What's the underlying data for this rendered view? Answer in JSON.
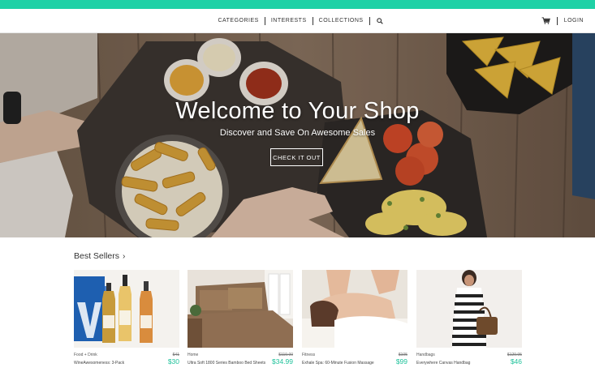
{
  "colors": {
    "accent": "#1fd1a6",
    "price": "#1fc29b"
  },
  "nav": {
    "links": [
      "CATEGORIES",
      "INTERESTS",
      "COLLECTIONS"
    ],
    "search_icon": "search-icon",
    "cart_icon": "cart-icon",
    "login": "LOGIN"
  },
  "hero": {
    "title": "Welcome to Your Shop",
    "subtitle": "Discover and Save On Awesome Sales",
    "button": "CHECK IT OUT"
  },
  "best_sellers": {
    "title": "Best Sellers",
    "chevron": "›",
    "items": [
      {
        "category": "Food + Drink",
        "name": "WineAwesomeness: 3-Pack",
        "old_price": "$41",
        "price": "$30"
      },
      {
        "category": "Home",
        "name": "Ultra Soft 1800 Series Bamboo Bed Sheets",
        "old_price": "$119.00",
        "price": "$34.99"
      },
      {
        "category": "Fitness",
        "name": "Exhale Spa: 60-Minute Fusion Massage",
        "old_price": "$105",
        "price": "$99"
      },
      {
        "category": "Handbags",
        "name": "Everywhere Canvas Handbag",
        "old_price": "$129.95",
        "price": "$46"
      }
    ]
  }
}
